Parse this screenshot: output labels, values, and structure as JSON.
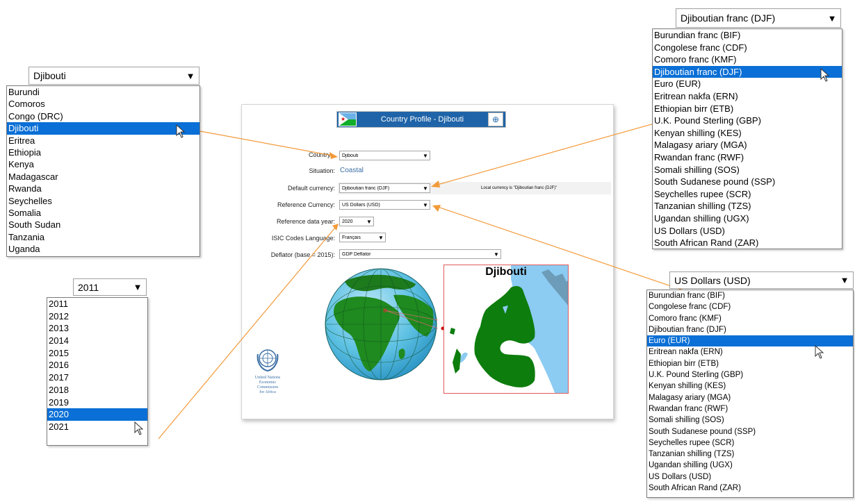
{
  "form": {
    "title": "Country Profile - Djibouti",
    "country_label": "Country:",
    "country_value": "Djibouti",
    "situation_label": "Situation:",
    "situation_value": "Coastal",
    "default_currency_label": "Default currency:",
    "default_currency_value": "Djiboutian franc (DJF)",
    "local_currency_note": "Local currency is \"Djiboutian franc (DJF)\"",
    "reference_currency_label": "Reference Currency:",
    "reference_currency_value": "US Dollars (USD)",
    "reference_year_label": "Reference data year:",
    "reference_year_value": "2020",
    "isic_label": "ISIC Codes Language:",
    "isic_value": "Français",
    "deflator_label": "Deflator (base = 2015):",
    "deflator_value": "GDP Deflator"
  },
  "map": {
    "title": "Djibouti"
  },
  "logo": {
    "line1": "United Nations",
    "line2": "Economic Commission",
    "line3": "for Africa"
  },
  "country_dropdown": {
    "selected": "Djibouti",
    "options": [
      "Burundi",
      "Comoros",
      "Congo (DRC)",
      "Djibouti",
      "Eritrea",
      "Ethiopia",
      "Kenya",
      "Madagascar",
      "Rwanda",
      "Seychelles",
      "Somalia",
      "South Sudan",
      "Tanzania",
      "Uganda"
    ],
    "highlighted": "Djibouti"
  },
  "year_dropdown": {
    "selected": "2011",
    "options": [
      "2011",
      "2012",
      "2013",
      "2014",
      "2015",
      "2016",
      "2017",
      "2018",
      "2019",
      "2020",
      "2021"
    ],
    "highlighted": "2020"
  },
  "default_currency_dropdown": {
    "selected": "Djiboutian franc (DJF)",
    "options": [
      "Burundian franc (BIF)",
      "Congolese franc (CDF)",
      "Comoro franc (KMF)",
      "Djiboutian franc (DJF)",
      "Euro (EUR)",
      "Eritrean nakfa (ERN)",
      "Ethiopian birr (ETB)",
      "U.K. Pound Sterling (GBP)",
      "Kenyan shilling (KES)",
      "Malagasy ariary (MGA)",
      "Rwandan franc (RWF)",
      "Somali shilling (SOS)",
      "South Sudanese pound (SSP)",
      "Seychelles rupee (SCR)",
      "Tanzanian shilling (TZS)",
      "Ugandan shilling (UGX)",
      "US Dollars (USD)",
      "South African Rand (ZAR)"
    ],
    "highlighted": "Djiboutian franc (DJF)"
  },
  "reference_currency_dropdown": {
    "selected": "US Dollars (USD)",
    "options": [
      "Burundian franc (BIF)",
      "Congolese franc (CDF)",
      "Comoro franc (KMF)",
      "Djiboutian franc (DJF)",
      "Euro (EUR)",
      "Eritrean nakfa (ERN)",
      "Ethiopian birr (ETB)",
      "U.K. Pound Sterling (GBP)",
      "Kenyan shilling (KES)",
      "Malagasy ariary (MGA)",
      "Rwandan franc (RWF)",
      "Somali shilling (SOS)",
      "South Sudanese pound (SSP)",
      "Seychelles rupee (SCR)",
      "Tanzanian shilling (TZS)",
      "Ugandan shilling (UGX)",
      "US Dollars (USD)",
      "South African Rand (ZAR)"
    ],
    "highlighted": "Euro (EUR)"
  },
  "icons": {
    "dropdown_arrow": "triangle-down-icon",
    "cursor": "mouse-pointer-icon",
    "flag": "djibouti-flag-icon",
    "emblem": "un-emblem-icon"
  },
  "colors": {
    "accent": "#1f64a8",
    "selection": "#0a6fd6",
    "callout_line": "#f39a3a",
    "land": "#0d7d0d",
    "water": "#8ccbf2"
  }
}
